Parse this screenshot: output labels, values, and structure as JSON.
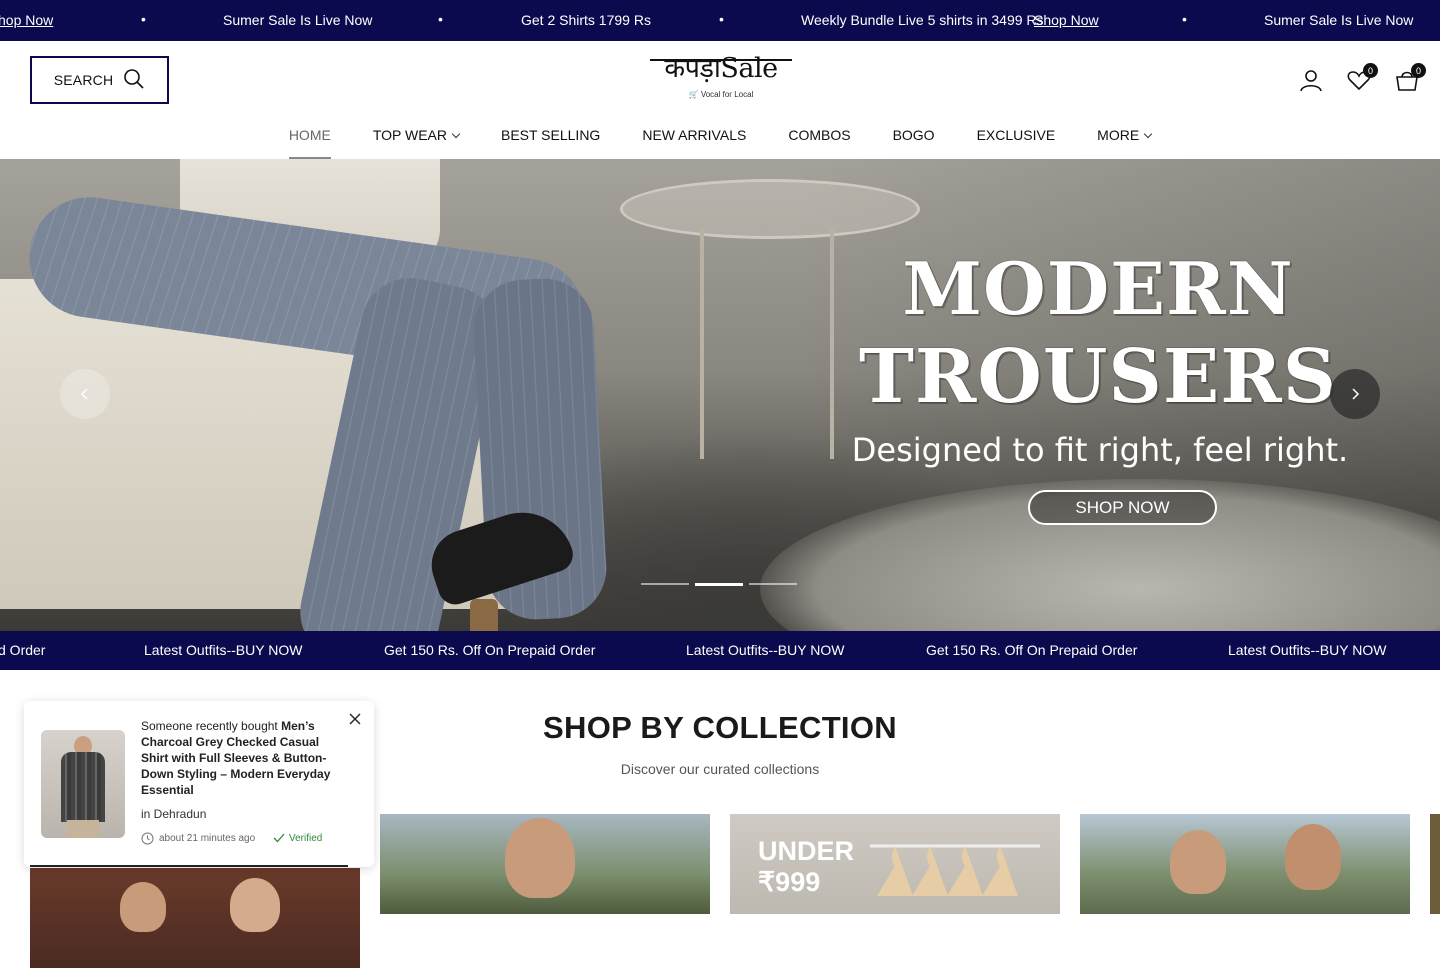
{
  "topbar": {
    "messages": [
      {
        "text": "hop Now",
        "link": true
      },
      {
        "text": "Sumer Sale Is Live Now"
      },
      {
        "text": "Get 2 Shirts 1799 Rs"
      },
      {
        "text": "Weekly Bundle Live 5 shirts in 3499 Rs"
      },
      {
        "text": "Shop Now",
        "link": true
      },
      {
        "text": "Sumer Sale Is Live Now"
      }
    ],
    "separator": "•"
  },
  "header": {
    "search_label": "SEARCH",
    "logo_text": "कपड़ाSale",
    "logo_tagline": "🛒 Vocal for Local",
    "wishlist_count": "0",
    "cart_count": "0"
  },
  "nav": {
    "items": [
      {
        "label": "HOME",
        "active": true
      },
      {
        "label": "TOP WEAR",
        "dropdown": true
      },
      {
        "label": "BEST SELLING"
      },
      {
        "label": "NEW ARRIVALS"
      },
      {
        "label": "COMBOS"
      },
      {
        "label": "BOGO"
      },
      {
        "label": "EXCLUSIVE"
      },
      {
        "label": "MORE",
        "dropdown": true
      }
    ]
  },
  "hero": {
    "title_line1": "MODERN",
    "title_line2": "TROUSERS",
    "subtitle": "Designed to fit right, feel right.",
    "cta": "SHOP NOW",
    "slides": 3,
    "active_slide": 2
  },
  "subbar": {
    "messages": [
      "d Order",
      "Latest Outfits--BUY NOW",
      "Get 150 Rs. Off On Prepaid Order",
      "Latest Outfits--BUY NOW",
      "Get 150 Rs. Off On Prepaid Order",
      "Latest Outfits--BUY NOW"
    ]
  },
  "collection": {
    "title": "SHOP BY COLLECTION",
    "subtitle": "Discover our curated collections",
    "card3_tag_line1": "UNDER",
    "card3_tag_line2": "₹999"
  },
  "popup": {
    "prefix": "Someone recently bought",
    "product": "Men’s Charcoal Grey Checked Casual Shirt with Full Sleeves & Button-Down Styling – Modern Everyday Essential",
    "location": "in Dehradun",
    "time": "about 21 minutes ago",
    "verified": "Verified"
  },
  "colors": {
    "brand_navy": "#0c0a4e",
    "verified_green": "#2e8b3a"
  }
}
